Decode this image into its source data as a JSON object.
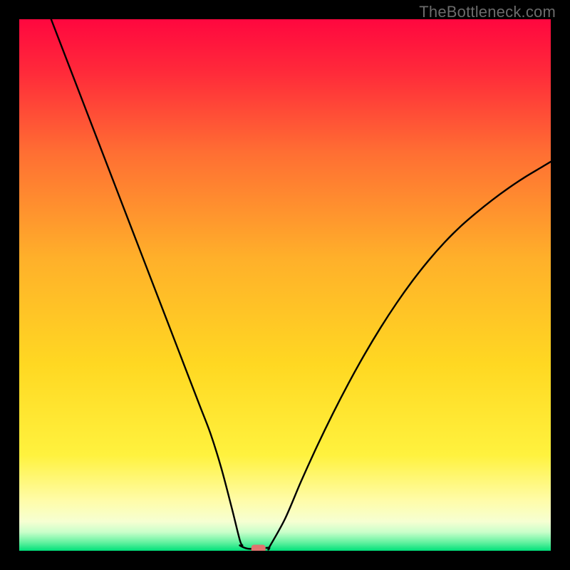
{
  "watermark": "TheBottleneck.com",
  "chart_data": {
    "type": "line",
    "title": "",
    "xlabel": "",
    "ylabel": "",
    "xlim": [
      0,
      1
    ],
    "ylim": [
      0,
      1
    ],
    "background_gradient": {
      "top_color": "#ff0040",
      "mid_color": "#ffd400",
      "bottom_near_color": "#fff9c8",
      "bottom_color": "#00e07a"
    },
    "plot_background_border": "#000000",
    "curve_color": "#000000",
    "series": [
      {
        "name": "left-branch",
        "x": [
          0.06,
          0.08,
          0.1,
          0.12,
          0.14,
          0.16,
          0.18,
          0.2,
          0.22,
          0.24,
          0.26,
          0.28,
          0.3,
          0.32,
          0.34,
          0.36,
          0.38,
          0.4,
          0.415,
          0.42
        ],
        "y": [
          1.0,
          0.948,
          0.896,
          0.844,
          0.792,
          0.74,
          0.688,
          0.636,
          0.584,
          0.532,
          0.48,
          0.428,
          0.376,
          0.324,
          0.272,
          0.22,
          0.156,
          0.08,
          0.02,
          0.01
        ]
      },
      {
        "name": "trough",
        "x": [
          0.415,
          0.43,
          0.45,
          0.47
        ],
        "y": [
          0.01,
          0.004,
          0.004,
          0.006
        ]
      },
      {
        "name": "right-branch",
        "x": [
          0.47,
          0.5,
          0.53,
          0.56,
          0.59,
          0.62,
          0.65,
          0.68,
          0.71,
          0.74,
          0.77,
          0.8,
          0.83,
          0.86,
          0.89,
          0.92,
          0.95,
          0.98,
          1.0
        ],
        "y": [
          0.006,
          0.06,
          0.13,
          0.196,
          0.258,
          0.316,
          0.37,
          0.42,
          0.466,
          0.508,
          0.546,
          0.58,
          0.61,
          0.636,
          0.66,
          0.682,
          0.702,
          0.72,
          0.732
        ]
      }
    ],
    "marker": {
      "x": 0.45,
      "y": 0.004,
      "color": "#e0746f",
      "shape": "rounded-rect"
    }
  }
}
